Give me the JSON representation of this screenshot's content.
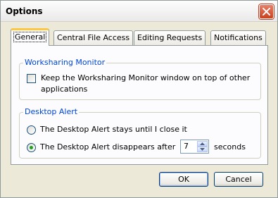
{
  "window": {
    "title": "Options"
  },
  "tabs": [
    {
      "label": "General",
      "active": true
    },
    {
      "label": "Central File Access",
      "active": false
    },
    {
      "label": "Editing Requests",
      "active": false
    },
    {
      "label": "Notifications",
      "active": false
    }
  ],
  "worksharing": {
    "group_label": "Worksharing Monitor",
    "checkbox_line1": "Keep the Worksharing Monitor window on top of other",
    "checkbox_line2": "applications",
    "checked": false
  },
  "desktop_alert": {
    "group_label": "Desktop Alert",
    "option_stay": "The Desktop Alert stays until I close it",
    "option_disappear": "The Desktop Alert disappears after",
    "selected": "disappear",
    "seconds_value": "7",
    "seconds_unit": "seconds"
  },
  "buttons": {
    "ok": "OK",
    "cancel": "Cancel"
  },
  "colors": {
    "accent_group_label": "#0046d5",
    "close_button": "#c8411f",
    "active_tab_highlight": "#ffc83c",
    "radio_dot": "#21a121"
  }
}
